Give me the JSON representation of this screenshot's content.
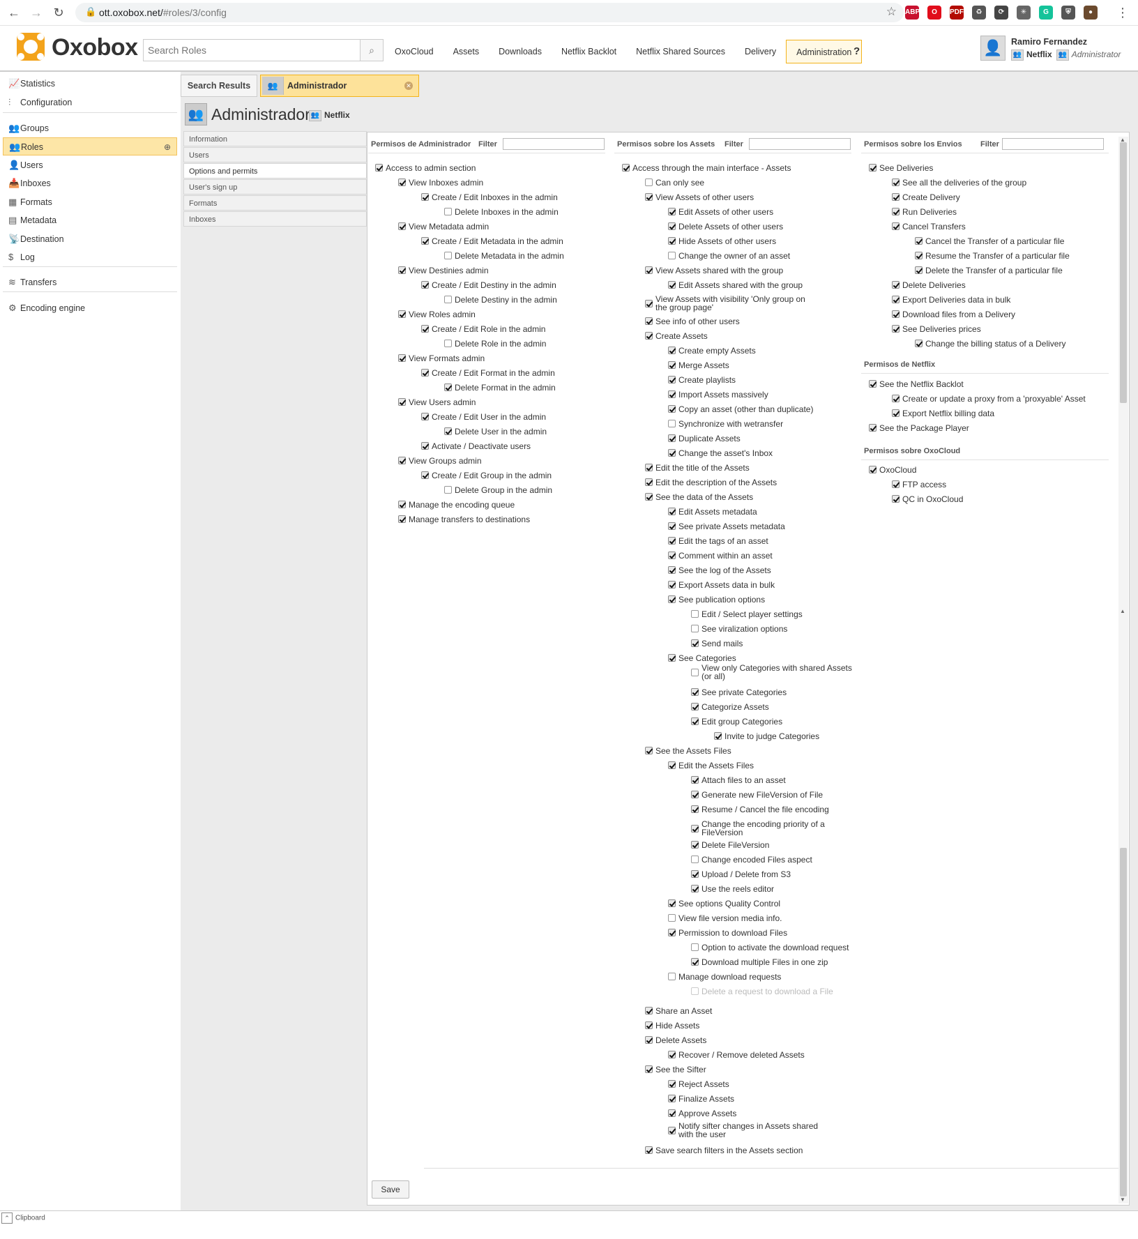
{
  "browser": {
    "url_host": "ott.oxobox.net/",
    "url_path": "#roles/3/config",
    "extensions": [
      {
        "name": "abp-icon",
        "label": "ABP",
        "color": "#c8102e"
      },
      {
        "name": "opera-icon",
        "label": "O",
        "color": "#e10d1b"
      },
      {
        "name": "pdf-icon",
        "label": "PDF",
        "color": "#b30b00"
      },
      {
        "name": "recycle-icon",
        "label": "♻",
        "color": "#555555"
      },
      {
        "name": "sync-icon",
        "label": "⟳",
        "color": "#444444"
      },
      {
        "name": "snowflake-icon",
        "label": "✳",
        "color": "#666666"
      },
      {
        "name": "grammarly-icon",
        "label": "G",
        "color": "#15c39a"
      },
      {
        "name": "shield-icon",
        "label": "⛨",
        "color": "#555555"
      },
      {
        "name": "profile-icon",
        "label": "●",
        "color": "#6b4a2e"
      }
    ]
  },
  "header": {
    "logo": "Oxobox",
    "search_placeholder": "Search Roles",
    "nav": [
      "OxoCloud",
      "Assets",
      "Downloads",
      "Netflix Backlot",
      "Netflix Shared Sources",
      "Delivery",
      "Administration"
    ],
    "active_nav": "Administration",
    "help": "?",
    "user_name": "Ramiro Fernandez",
    "user_group": "Netflix",
    "user_role": "Administrator"
  },
  "colors": {
    "accent": "#f3b31b",
    "accent_bg": "#fde29a",
    "sidebar_active": "#fde6a7"
  },
  "sidebar": {
    "items": [
      {
        "label": "Statistics",
        "icon": "chart-icon",
        "glyph": "📈"
      },
      {
        "label": "Configuration",
        "icon": "sliders-icon",
        "glyph": "⫶"
      },
      {
        "label": "Groups",
        "icon": "group-icon",
        "glyph": "👥"
      },
      {
        "label": "Roles",
        "icon": "roles-icon",
        "glyph": "👥"
      },
      {
        "label": "Users",
        "icon": "user-icon",
        "glyph": "👤"
      },
      {
        "label": "Inboxes",
        "icon": "inbox-icon",
        "glyph": "📥"
      },
      {
        "label": "Formats",
        "icon": "formats-icon",
        "glyph": "▦"
      },
      {
        "label": "Metadata",
        "icon": "metadata-icon",
        "glyph": "▤"
      },
      {
        "label": "Destination",
        "icon": "antenna-icon",
        "glyph": "📡"
      },
      {
        "label": "Log",
        "icon": "log-icon",
        "glyph": "$"
      },
      {
        "label": "Transfers",
        "icon": "wifi-icon",
        "glyph": "≋"
      },
      {
        "label": "Encoding engine",
        "icon": "gear-icon",
        "glyph": "⚙"
      }
    ]
  },
  "tabs": {
    "search_results": "Search Results",
    "role": "Administrador"
  },
  "page": {
    "title": "Administrador",
    "group": "Netflix"
  },
  "inner_menu": [
    "Information",
    "Users",
    "Options and permits",
    "User's sign up",
    "Formats",
    "Inboxes"
  ],
  "columns": {
    "admin": {
      "title": "Permisos de Administrador",
      "filter": "Filter"
    },
    "assets": {
      "title": "Permisos sobre los Assets",
      "filter": "Filter"
    },
    "envios": {
      "title": "Permisos sobre los Envios",
      "filter": "Filter"
    }
  },
  "sections": {
    "netflix": "Permisos de Netflix",
    "oxocloud": "Permisos sobre OxoCloud"
  },
  "admin_perms": [
    [
      "Access to admin section",
      0,
      1
    ],
    [
      "View Inboxes admin",
      1,
      1
    ],
    [
      "Create / Edit Inboxes in the admin",
      2,
      1
    ],
    [
      "Delete Inboxes in the admin",
      3,
      0
    ],
    [
      "View Metadata admin",
      1,
      1
    ],
    [
      "Create / Edit Metadata in the admin",
      2,
      1
    ],
    [
      "Delete Metadata in the admin",
      3,
      0
    ],
    [
      "View Destinies admin",
      1,
      1
    ],
    [
      "Create / Edit Destiny in the admin",
      2,
      1
    ],
    [
      "Delete Destiny in the admin",
      3,
      0
    ],
    [
      "View Roles admin",
      1,
      1
    ],
    [
      "Create / Edit Role in the admin",
      2,
      1
    ],
    [
      "Delete Role in the admin",
      3,
      0
    ],
    [
      "View Formats admin",
      1,
      1
    ],
    [
      "Create / Edit Format in the admin",
      2,
      1
    ],
    [
      "Delete Format in the admin",
      3,
      1
    ],
    [
      "View Users admin",
      1,
      1
    ],
    [
      "Create / Edit User in the admin",
      2,
      1
    ],
    [
      "Delete User in the admin",
      3,
      1
    ],
    [
      "Activate / Deactivate users",
      2,
      1
    ],
    [
      "View Groups admin",
      1,
      1
    ],
    [
      "Create / Edit Group in the admin",
      2,
      1
    ],
    [
      "Delete Group in the admin",
      3,
      0
    ],
    [
      "Manage the encoding queue",
      1,
      1
    ],
    [
      "Manage transfers to destinations",
      1,
      1
    ]
  ],
  "asset_perms": [
    [
      "Access through the main interface - Assets",
      0,
      1,
      0
    ],
    [
      "Can only see",
      1,
      0,
      0
    ],
    [
      "View Assets of other users",
      1,
      1,
      0
    ],
    [
      "Edit Assets of other users",
      2,
      1,
      0
    ],
    [
      "Delete Assets of other users",
      2,
      1,
      0
    ],
    [
      "Hide Assets of other users",
      2,
      1,
      0
    ],
    [
      "Change the owner of an asset",
      2,
      0,
      0
    ],
    [
      "View Assets shared with the group",
      1,
      1,
      0
    ],
    [
      "Edit Assets shared with the group",
      2,
      1,
      0
    ],
    [
      "View Assets with visibility 'Only group on the group page'",
      1,
      1,
      1
    ],
    [
      "See info of other users",
      1,
      1,
      0
    ],
    [
      "Create Assets",
      1,
      1,
      0
    ],
    [
      "Create empty Assets",
      2,
      1,
      0
    ],
    [
      "Merge Assets",
      2,
      1,
      0
    ],
    [
      "Create playlists",
      2,
      1,
      0
    ],
    [
      "Import Assets massively",
      2,
      1,
      0
    ],
    [
      "Copy an asset (other than duplicate)",
      2,
      1,
      0
    ],
    [
      "Synchronize with wetransfer",
      2,
      0,
      0
    ],
    [
      "Duplicate Assets",
      2,
      1,
      0
    ],
    [
      "Change the asset's Inbox",
      2,
      1,
      0
    ],
    [
      "Edit the title of the Assets",
      1,
      1,
      0
    ],
    [
      "Edit the description of the Assets",
      1,
      1,
      0
    ],
    [
      "See the data of the Assets",
      1,
      1,
      0
    ],
    [
      "Edit Assets metadata",
      2,
      1,
      0
    ],
    [
      "See private Assets metadata",
      2,
      1,
      0
    ],
    [
      "Edit the tags of an asset",
      2,
      1,
      0
    ],
    [
      "Comment within an asset",
      2,
      1,
      0
    ],
    [
      "See the log of the Assets",
      2,
      1,
      0
    ],
    [
      "Export Assets data in bulk",
      2,
      1,
      0
    ],
    [
      "See publication options",
      2,
      1,
      0
    ],
    [
      "Edit / Select player settings",
      3,
      0,
      0
    ],
    [
      "See viralization options",
      3,
      0,
      0
    ],
    [
      "Send mails",
      3,
      1,
      0
    ],
    [
      "See Categories",
      2,
      1,
      0
    ],
    [
      "View only Categories with shared Assets (or all)",
      3,
      0,
      1
    ],
    [
      "See private Categories",
      3,
      1,
      0
    ],
    [
      "Categorize Assets",
      3,
      1,
      0
    ],
    [
      "Edit group Categories",
      3,
      1,
      0
    ],
    [
      "Invite to judge Categories",
      4,
      1,
      0
    ],
    [
      "See the Assets Files",
      1,
      1,
      0
    ],
    [
      "Edit the Assets Files",
      2,
      1,
      0
    ],
    [
      "Attach files to an asset",
      3,
      1,
      0
    ],
    [
      "Generate new FileVersion of File",
      3,
      1,
      0
    ],
    [
      "Resume / Cancel the file encoding",
      3,
      1,
      0
    ],
    [
      "Change the encoding priority of a FileVersion",
      3,
      1,
      1
    ],
    [
      "Delete FileVersion",
      3,
      1,
      0
    ],
    [
      "Change encoded Files aspect",
      3,
      0,
      0
    ],
    [
      "Upload / Delete from S3",
      3,
      1,
      0
    ],
    [
      "Use the reels editor",
      3,
      1,
      0
    ],
    [
      "See options Quality Control",
      2,
      1,
      0
    ],
    [
      "View file version media info.",
      2,
      0,
      0
    ],
    [
      "Permission to download Files",
      2,
      1,
      0
    ],
    [
      "Option to activate the download request",
      3,
      0,
      0
    ],
    [
      "Download multiple Files in one zip",
      3,
      1,
      0
    ],
    [
      "Manage download requests",
      2,
      0,
      0
    ],
    [
      "Delete a request to download a File",
      3,
      0,
      2
    ],
    [
      "Share an Asset",
      1,
      1,
      0
    ],
    [
      "Hide Assets",
      1,
      1,
      0
    ],
    [
      "Delete Assets",
      1,
      1,
      0
    ],
    [
      "Recover / Remove deleted Assets",
      2,
      1,
      0
    ],
    [
      "See the Sifter",
      1,
      1,
      0
    ],
    [
      "Reject Assets",
      2,
      1,
      0
    ],
    [
      "Finalize Assets",
      2,
      1,
      0
    ],
    [
      "Approve Assets",
      2,
      1,
      0
    ],
    [
      "Notify sifter changes in Assets shared with the user",
      2,
      1,
      1
    ],
    [
      "Save search filters in the Assets section",
      1,
      1,
      0
    ]
  ],
  "envio_perms": [
    [
      "See Deliveries",
      0,
      1
    ],
    [
      "See all the deliveries of the group",
      1,
      1
    ],
    [
      "Create Delivery",
      1,
      1
    ],
    [
      "Run Deliveries",
      1,
      1
    ],
    [
      "Cancel Transfers",
      1,
      1
    ],
    [
      "Cancel the Transfer of a particular file",
      2,
      1
    ],
    [
      "Resume the Transfer of a particular file",
      2,
      1
    ],
    [
      "Delete the Transfer of a particular file",
      2,
      1
    ],
    [
      "Delete Deliveries",
      1,
      1
    ],
    [
      "Export Deliveries data in bulk",
      1,
      1
    ],
    [
      "Download files from a Delivery",
      1,
      1
    ],
    [
      "See Deliveries prices",
      1,
      1
    ],
    [
      "Change the billing status of a Delivery",
      2,
      1
    ]
  ],
  "netflix_perms": [
    [
      "See the Netflix Backlot",
      0,
      1
    ],
    [
      "Create or update a proxy from a 'proxyable' Asset",
      1,
      1
    ],
    [
      "Export Netflix billing data",
      1,
      1
    ],
    [
      "See the Package Player",
      0,
      1
    ]
  ],
  "oxocloud_perms": [
    [
      "OxoCloud",
      0,
      1
    ],
    [
      "FTP access",
      1,
      1
    ],
    [
      "QC in OxoCloud",
      1,
      1
    ]
  ],
  "save_label": "Save",
  "bottom": {
    "clipboard": "Clipboard"
  }
}
